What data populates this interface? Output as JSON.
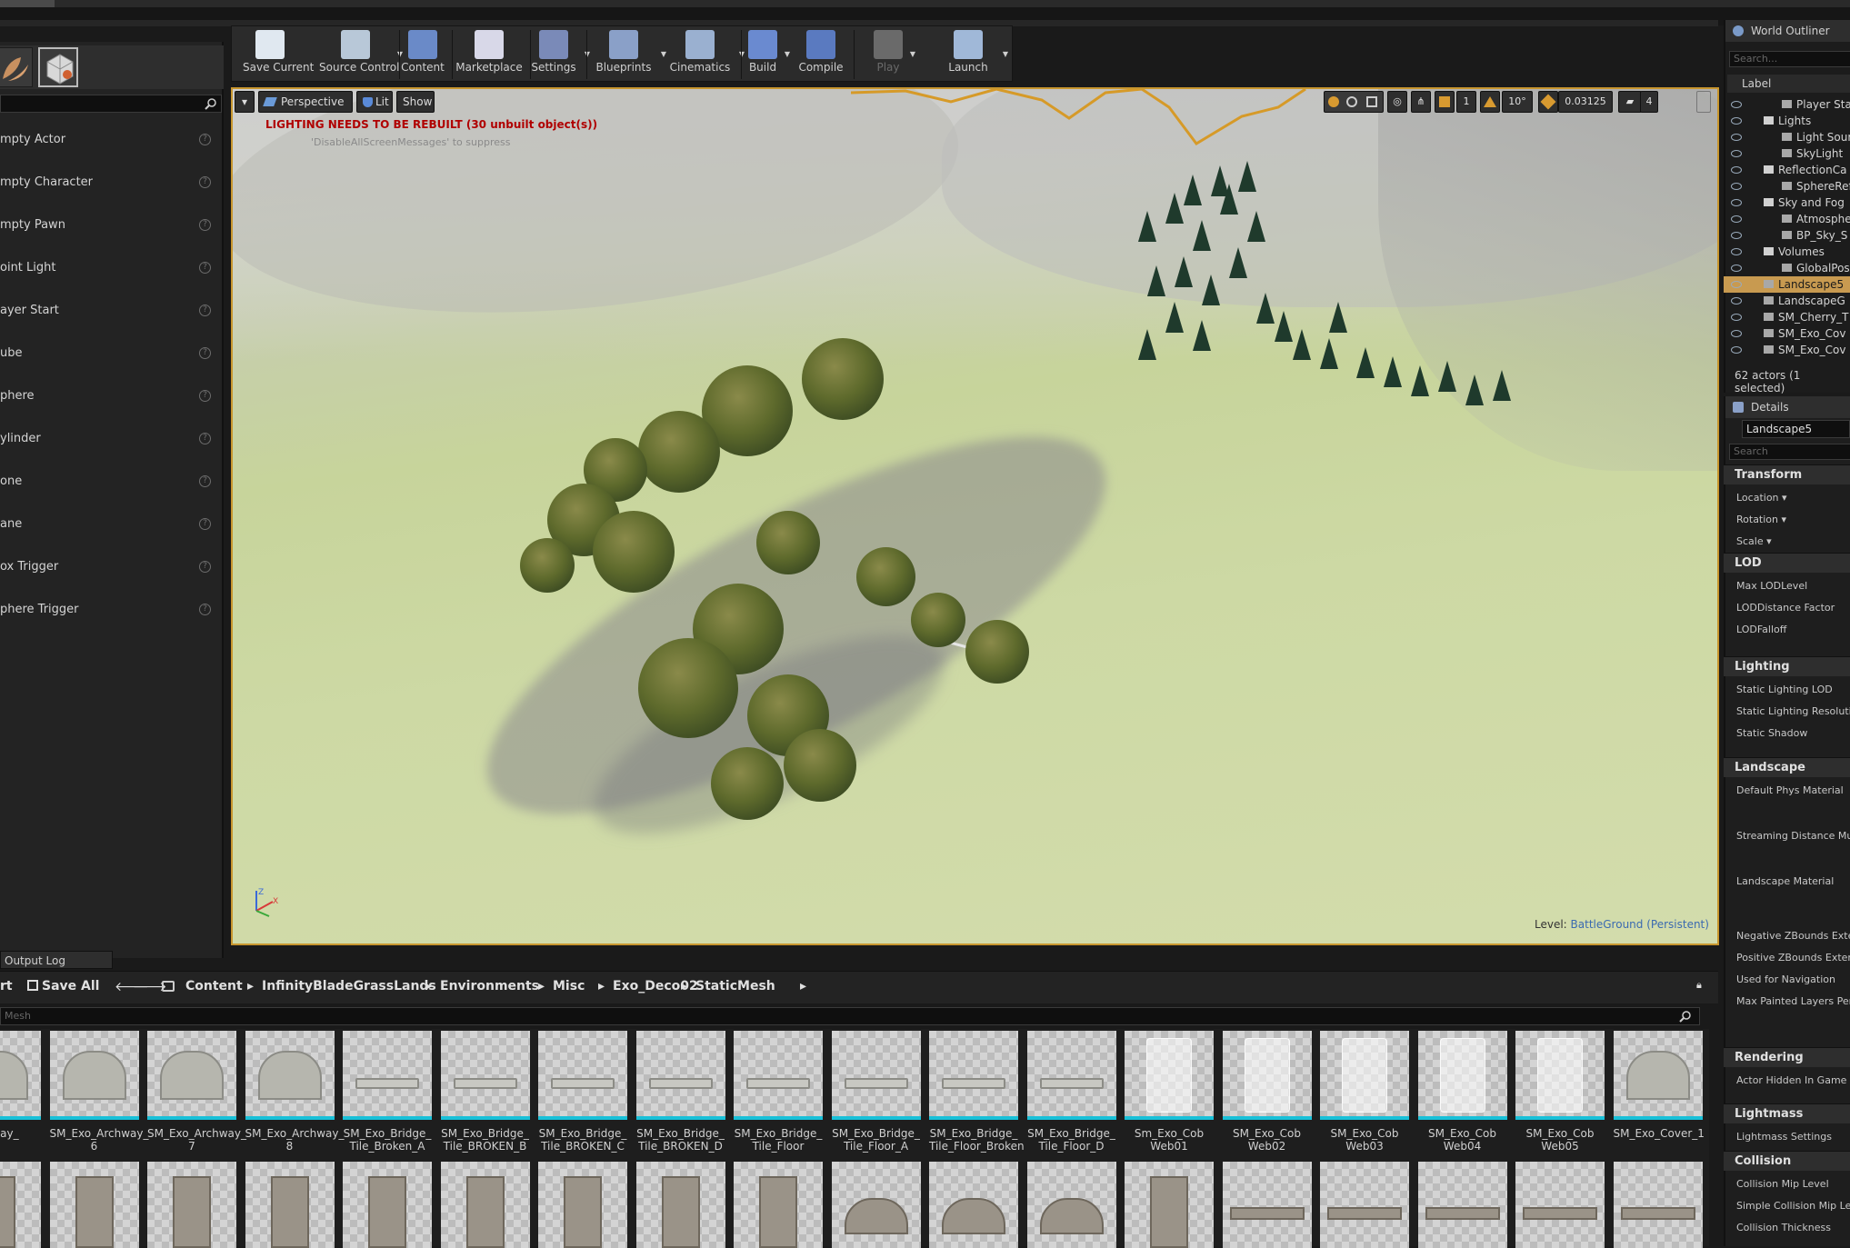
{
  "toolbar": [
    {
      "label": "Save Current",
      "icon": "save-icon",
      "color": "#e0e8f0",
      "dropdown": false
    },
    {
      "label": "Source Control",
      "icon": "source-control-icon",
      "color": "#b8c8d8",
      "dropdown": true
    },
    {
      "label": "Content",
      "icon": "content-icon",
      "color": "#6a8ac8",
      "dropdown": false
    },
    {
      "label": "Marketplace",
      "icon": "marketplace-icon",
      "color": "#d8d8e8",
      "dropdown": false
    },
    {
      "label": "Settings",
      "icon": "settings-icon",
      "color": "#7a8ab8",
      "dropdown": true
    },
    {
      "label": "Blueprints",
      "icon": "blueprints-icon",
      "color": "#8aa0c8",
      "dropdown": true
    },
    {
      "label": "Cinematics",
      "icon": "cinematics-icon",
      "color": "#9ab0d0",
      "dropdown": true
    },
    {
      "label": "Build",
      "icon": "build-icon",
      "color": "#6a8ad0",
      "dropdown": true
    },
    {
      "label": "Compile",
      "icon": "compile-icon",
      "color": "#5a7ac0",
      "dropdown": false
    },
    {
      "label": "Play",
      "icon": "play-icon",
      "color": "#6a6a6a",
      "dropdown": true
    },
    {
      "label": "Launch",
      "icon": "launch-icon",
      "color": "#a0b8d8",
      "dropdown": true
    }
  ],
  "place_actors": [
    "mpty Actor",
    "mpty Character",
    "mpty Pawn",
    "oint Light",
    "ayer Start",
    "ube",
    "phere",
    "ylinder",
    "one",
    "ane",
    "ox Trigger",
    "phere Trigger"
  ],
  "viewport": {
    "menu_arrow": "▾",
    "perspective": "Perspective",
    "lit": "Lit",
    "show": "Show",
    "warning": "LIGHTING NEEDS TO BE REBUILT (30 unbuilt object(s))",
    "suppress": "'DisableAllScreenMessages' to suppress",
    "snap_grid": "1",
    "snap_rot": "10°",
    "snap_scale": "0.03125",
    "cam_speed": "4",
    "level_label": "Level:",
    "level_name": "BattleGround (Persistent)"
  },
  "output_log": "Output Log",
  "content_browser": {
    "import_fragment": "rt",
    "save_all": "Save All",
    "path": [
      "Content",
      "InfinityBladeGrassLands",
      "Environments",
      "Misc",
      "Exo_Deco02",
      "StaticMesh"
    ],
    "search_placeholder": "Mesh",
    "assets_row1": [
      {
        "label": "rchway_\n",
        "kind": "arch"
      },
      {
        "label": "SM_Exo_Archway_\n6",
        "kind": "arch"
      },
      {
        "label": "SM_Exo_Archway_\n7",
        "kind": "arch"
      },
      {
        "label": "SM_Exo_Archway_\n8",
        "kind": "arch"
      },
      {
        "label": "SM_Exo_Bridge_\nTile_Broken_A",
        "kind": "flat"
      },
      {
        "label": "SM_Exo_Bridge_\nTile_BROKEN_B",
        "kind": "flat"
      },
      {
        "label": "SM_Exo_Bridge_\nTile_BROKEN_C",
        "kind": "flat"
      },
      {
        "label": "SM_Exo_Bridge_\nTile_BROKEN_D",
        "kind": "flat"
      },
      {
        "label": "SM_Exo_Bridge_\nTile_Floor",
        "kind": "flat"
      },
      {
        "label": "SM_Exo_Bridge_\nTile_Floor_A",
        "kind": "flat"
      },
      {
        "label": "SM_Exo_Bridge_\nTile_Floor_Broken",
        "kind": "flat"
      },
      {
        "label": "SM_Exo_Bridge_\nTile_Floor_D",
        "kind": "flat"
      },
      {
        "label": "Sm_Exo_Cob\nWeb01",
        "kind": "sheet"
      },
      {
        "label": "SM_Exo_Cob\nWeb02",
        "kind": "sheet"
      },
      {
        "label": "SM_Exo_Cob\nWeb03",
        "kind": "sheet"
      },
      {
        "label": "SM_Exo_Cob\nWeb04",
        "kind": "sheet"
      },
      {
        "label": "SM_Exo_Cob\nWeb05",
        "kind": "sheet"
      },
      {
        "label": "SM_Exo_Cover_1",
        "kind": "arch"
      }
    ]
  },
  "outliner": {
    "title": "World Outliner",
    "search_placeholder": "Search...",
    "label_col": "Label",
    "rows": [
      {
        "label": "Player Sta",
        "indent": 2,
        "selected": false
      },
      {
        "label": "Lights",
        "indent": 1,
        "selected": false
      },
      {
        "label": "Light Sour",
        "indent": 2,
        "selected": false
      },
      {
        "label": "SkyLight",
        "indent": 2,
        "selected": false
      },
      {
        "label": "ReflectionCa",
        "indent": 1,
        "selected": false
      },
      {
        "label": "SphereRef",
        "indent": 2,
        "selected": false
      },
      {
        "label": "Sky and Fog",
        "indent": 1,
        "selected": false
      },
      {
        "label": "Atmosphe",
        "indent": 2,
        "selected": false
      },
      {
        "label": "BP_Sky_S",
        "indent": 2,
        "selected": false
      },
      {
        "label": "Volumes",
        "indent": 1,
        "selected": false
      },
      {
        "label": "GlobalPos",
        "indent": 2,
        "selected": false
      },
      {
        "label": "Landscape5",
        "indent": 1,
        "selected": true
      },
      {
        "label": "LandscapeG",
        "indent": 1,
        "selected": false
      },
      {
        "label": "SM_Cherry_T",
        "indent": 1,
        "selected": false
      },
      {
        "label": "SM_Exo_Cov",
        "indent": 1,
        "selected": false
      },
      {
        "label": "SM_Exo_Cov",
        "indent": 1,
        "selected": false
      }
    ],
    "count": "62 actors (1 selected)"
  },
  "details": {
    "title": "Details",
    "actor_name": "Landscape5",
    "search_placeholder": "Search",
    "sections": [
      {
        "title": "Transform",
        "props": [
          "Location ▾",
          "Rotation ▾",
          "Scale ▾"
        ]
      },
      {
        "title": "LOD",
        "props": [
          "Max LODLevel",
          "LODDistance Factor",
          "LODFalloff"
        ]
      },
      {
        "title": "Lighting",
        "props": [
          "Static Lighting LOD",
          "Static Lighting Resolutio",
          "Static Shadow"
        ]
      },
      {
        "title": "Landscape",
        "props": [
          "Default Phys Material",
          "Streaming Distance Mult",
          "Landscape Material",
          "Negative ZBounds Exten",
          "Positive ZBounds Extens",
          "Used for Navigation",
          "Max Painted Layers Per"
        ]
      },
      {
        "title": "Rendering",
        "props": [
          "Actor Hidden In Game"
        ]
      },
      {
        "title": "Lightmass",
        "props": [
          "Lightmass Settings"
        ]
      },
      {
        "title": "Collision",
        "props": [
          "Collision Mip Level",
          "Simple Collision Mip Lev",
          "Collision Thickness"
        ]
      }
    ]
  }
}
